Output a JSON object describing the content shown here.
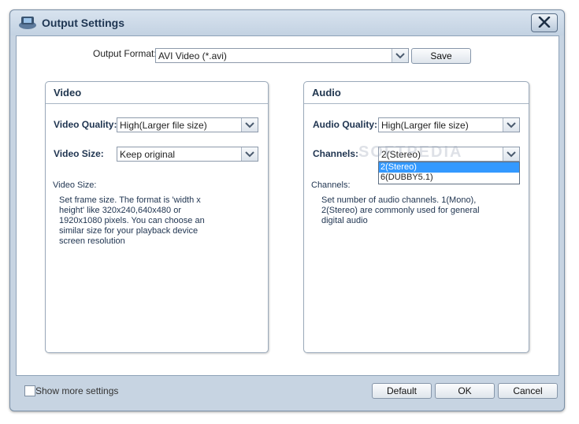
{
  "window": {
    "title": "Output Settings"
  },
  "top": {
    "format_label": "Output Format:",
    "format_value": "AVI Video (*.avi)",
    "save_label": "Save"
  },
  "video": {
    "title": "Video",
    "quality_label": "Video Quality:",
    "quality_value": "High(Larger file size)",
    "size_label": "Video Size:",
    "size_value": "Keep original",
    "help_title": "Video Size:",
    "help_lines": [
      "Set frame size. The format is 'width x",
      "height' like 320x240,640x480 or",
      "1920x1080 pixels. You can choose an",
      "similar size for your playback device",
      "screen resolution"
    ]
  },
  "audio": {
    "title": "Audio",
    "quality_label": "Audio Quality:",
    "quality_value": "High(Larger file size)",
    "channels_label": "Channels:",
    "channels_value": "2(Stereo)",
    "channels_options": [
      "2(Stereo)",
      "6(DUBBY5.1)"
    ],
    "help_title": "Channels:",
    "help_lines": [
      "Set number of audio channels. 1(Mono),",
      "2(Stereo) are commonly used for general",
      "digital audio"
    ]
  },
  "footer": {
    "show_more_label": "Show more settings",
    "show_more_checked": false,
    "default_label": "Default",
    "ok_label": "OK",
    "cancel_label": "Cancel"
  },
  "watermark": "SOFTPEDIA",
  "colors": {
    "accent": "#1f3450",
    "selection": "#3399ff",
    "chrome": "#c7d4e2"
  }
}
